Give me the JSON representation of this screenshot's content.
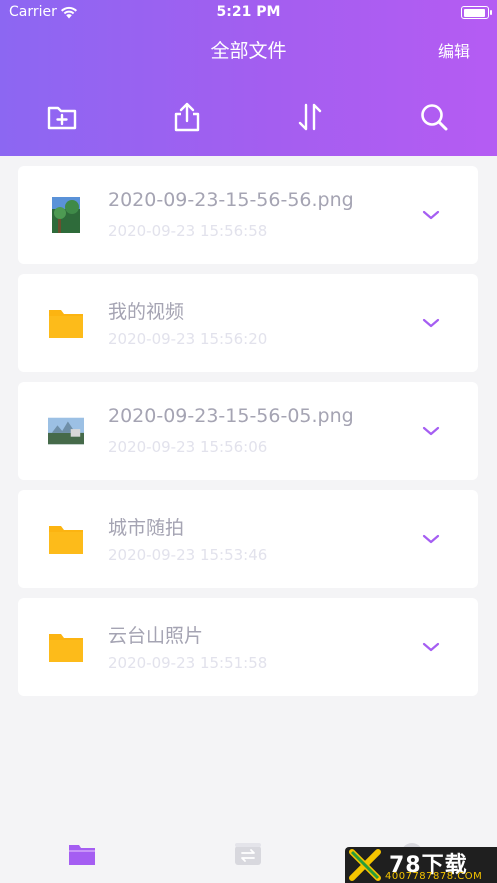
{
  "status_bar": {
    "carrier": "Carrier",
    "time": "5:21 PM"
  },
  "header": {
    "title": "全部文件",
    "edit_label": "编辑"
  },
  "toolbar": {
    "icons": [
      "new-folder-icon",
      "share-icon",
      "sort-icon",
      "search-icon"
    ]
  },
  "files": [
    {
      "name": "2020-09-23-15-56-56.png",
      "date": "2020-09-23 15:56:58",
      "kind": "image"
    },
    {
      "name": "我的视频",
      "date": "2020-09-23 15:56:20",
      "kind": "folder"
    },
    {
      "name": "2020-09-23-15-56-05.png",
      "date": "2020-09-23 15:56:06",
      "kind": "image"
    },
    {
      "name": "城市随拍",
      "date": "2020-09-23 15:53:46",
      "kind": "folder"
    },
    {
      "name": "云台山照片",
      "date": "2020-09-23 15:51:58",
      "kind": "folder"
    }
  ],
  "tabbar": {
    "icons": [
      "files-tab-icon",
      "transfer-tab-icon",
      "settings-tab-icon"
    ]
  },
  "watermark": {
    "main": "78下载",
    "sub": "4007787878.COM"
  },
  "colors": {
    "accent": "#a55ef2",
    "folder": "#fcb411",
    "background": "#f4f4f6"
  }
}
